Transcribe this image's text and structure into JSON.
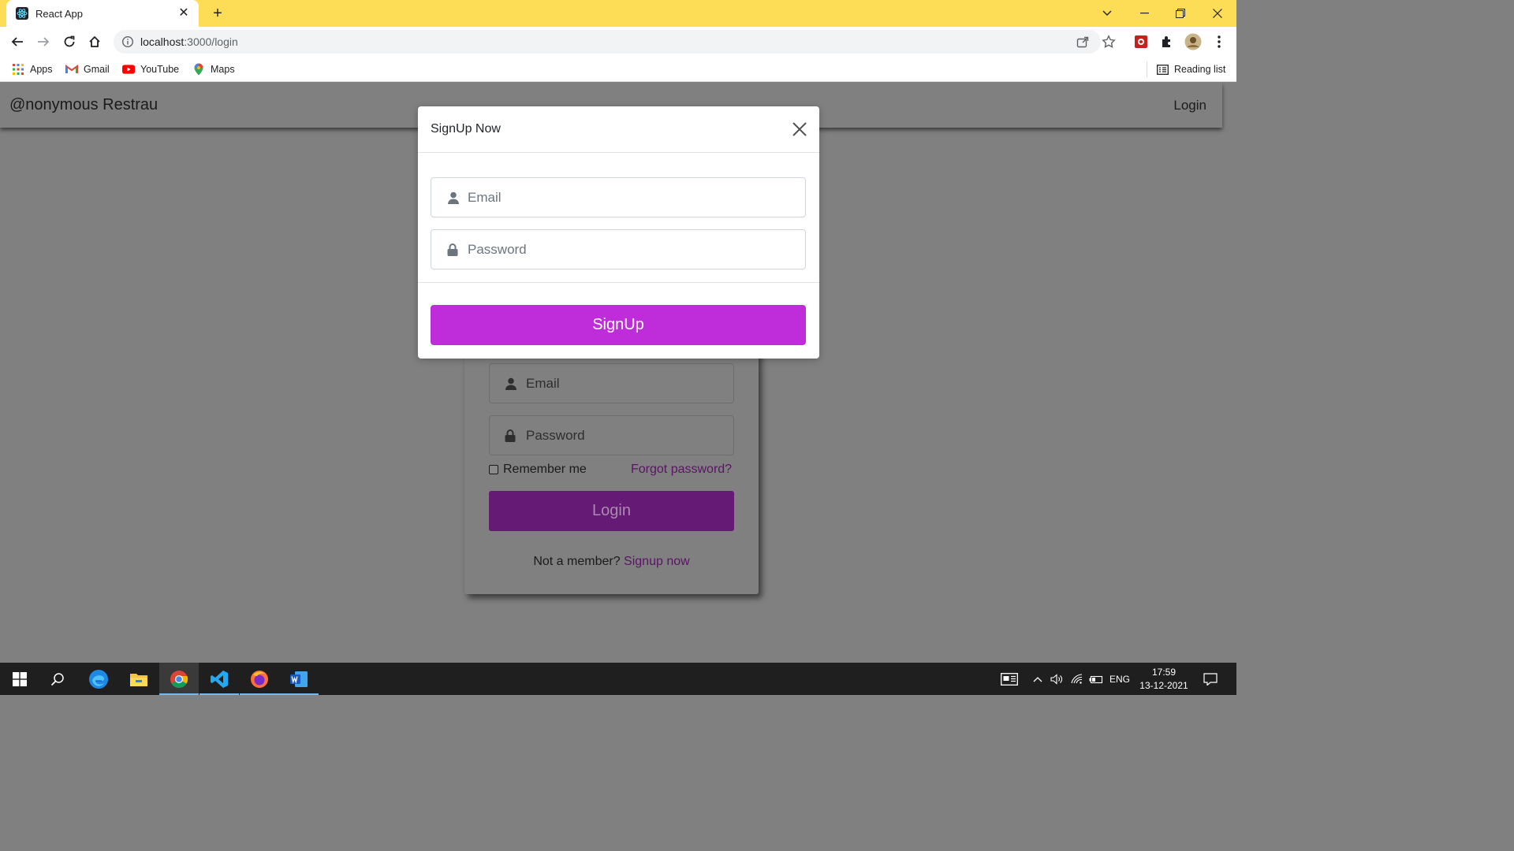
{
  "browser": {
    "tab_title": "React App",
    "new_tab_symbol": "+",
    "url_host": "localhost",
    "url_path": ":3000/login",
    "bookmarks": [
      {
        "label": "Apps",
        "icon": "apps-grid-icon"
      },
      {
        "label": "Gmail",
        "icon": "gmail-icon"
      },
      {
        "label": "YouTube",
        "icon": "youtube-icon"
      },
      {
        "label": "Maps",
        "icon": "maps-icon"
      }
    ],
    "reading_list": "Reading list"
  },
  "app": {
    "brand": "@nonymous Restrau",
    "nav_login": "Login"
  },
  "login_form": {
    "email_placeholder": "Email",
    "password_placeholder": "Password",
    "remember_me": "Remember me",
    "forgot_password": "Forgot password?",
    "login_button": "Login",
    "member_prompt": "Not a member?",
    "signup_link": "Signup now"
  },
  "modal": {
    "title": "SignUp Now",
    "email_placeholder": "Email",
    "password_placeholder": "Password",
    "signup_button": "SignUp"
  },
  "taskbar": {
    "language": "ENG",
    "time": "17:59",
    "date": "13-12-2021"
  },
  "colors": {
    "chrome_titlebar": "#fedd56",
    "signup_button": "#bf2ddb",
    "login_button": "#651a75",
    "overlay": "#808080"
  }
}
